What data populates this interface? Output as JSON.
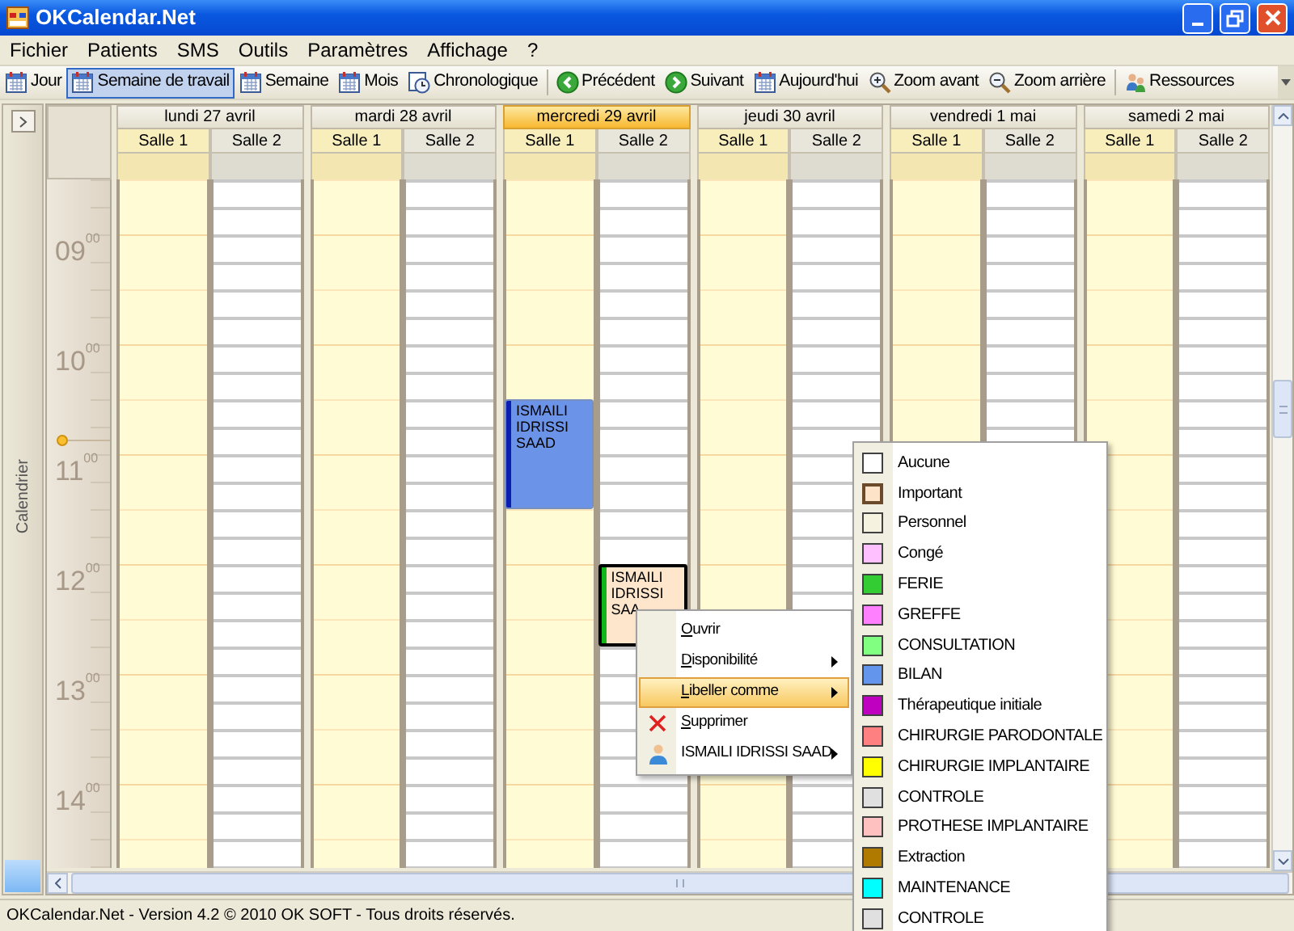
{
  "window": {
    "title": "OKCalendar.Net"
  },
  "menu_bar": [
    "Fichier",
    "Patients",
    "SMS",
    "Outils",
    "Paramètres",
    "Affichage",
    "?"
  ],
  "toolbar": {
    "groups": [
      [
        {
          "label": "Jour",
          "selected": false
        },
        {
          "label": "Semaine de travail",
          "selected": true
        },
        {
          "label": "Semaine",
          "selected": false
        },
        {
          "label": "Mois",
          "selected": false
        },
        {
          "label": "Chronologique",
          "selected": false
        }
      ],
      [
        {
          "label": "Précédent",
          "selected": false
        },
        {
          "label": "Suivant",
          "selected": false
        },
        {
          "label": "Aujourd'hui",
          "selected": false
        },
        {
          "label": "Zoom avant",
          "selected": false
        },
        {
          "label": "Zoom arrière",
          "selected": false
        }
      ],
      [
        {
          "label": "Ressources",
          "selected": false
        }
      ]
    ]
  },
  "side_panel": {
    "title": "Calendrier"
  },
  "calendar": {
    "hours": [
      "09$^{00}$",
      "10$^{00}$",
      "11$^{00}$",
      "12$^{00}$",
      "13$^{00}$",
      "14$^{00}$"
    ],
    "days": [
      {
        "label": "lundi 27 avril",
        "today": false,
        "rooms": [
          {
            "label": "Salle 1"
          },
          {
            "label": "Salle 2"
          }
        ]
      },
      {
        "label": "mardi 28 avril",
        "today": false,
        "rooms": [
          {
            "label": "Salle 1"
          },
          {
            "label": "Salle 2"
          }
        ]
      },
      {
        "label": "mercredi 29 avril",
        "today": true,
        "rooms": [
          {
            "label": "Salle 1",
            "appointments": [
              {
                "text": "ISMAILI IDRISSI SAAD",
                "color": "#6b94e8",
                "selected": false
              }
            ]
          },
          {
            "label": "Salle 2",
            "appointments": [
              {
                "text": "ISMAILI IDRISSI SAA",
                "color": "#fde6cc",
                "selected": true
              }
            ]
          }
        ]
      },
      {
        "label": "jeudi 30 avril",
        "today": false,
        "rooms": [
          {
            "label": "Salle 1"
          },
          {
            "label": "Salle 2"
          }
        ]
      },
      {
        "label": "vendredi 1 mai",
        "today": false,
        "rooms": [
          {
            "label": "Salle 1"
          },
          {
            "label": "Salle 2"
          }
        ]
      },
      {
        "label": "samedi 2 mai",
        "today": false,
        "rooms": [
          {
            "label": "Salle 1"
          },
          {
            "label": "Salle 2"
          }
        ]
      }
    ]
  },
  "context_menu": [
    {
      "label": "Ouvrir",
      "mnemonic": true,
      "submenu": false,
      "selected": false
    },
    {
      "label": "Disponibilité",
      "mnemonic": true,
      "submenu": true,
      "selected": false
    },
    {
      "label": "Libeller comme",
      "mnemonic": true,
      "submenu": true,
      "selected": true
    },
    {
      "label": "Supprimer",
      "mnemonic": true,
      "submenu": false,
      "selected": false,
      "kind": "delete"
    },
    {
      "label": "ISMAILI IDRISSI SAAD",
      "mnemonic": false,
      "submenu": true,
      "selected": false,
      "kind": "patient"
    }
  ],
  "label_submenu": [
    {
      "label": "Aucune",
      "color": "#ffffff",
      "selected": false
    },
    {
      "label": "Important",
      "color": "#fde3c8",
      "selected": true
    },
    {
      "label": "Personnel",
      "color": "#f5f3e0",
      "selected": false
    },
    {
      "label": "Congé",
      "color": "#ffc0ff",
      "selected": false
    },
    {
      "label": "FERIE",
      "color": "#33cc33",
      "selected": false
    },
    {
      "label": "GREFFE",
      "color": "#ff80ff",
      "selected": false
    },
    {
      "label": "CONSULTATION",
      "color": "#80ff80",
      "selected": false
    },
    {
      "label": "BILAN",
      "color": "#6495ed",
      "selected": false
    },
    {
      "label": "Thérapeutique initiale",
      "color": "#c000c0",
      "selected": false
    },
    {
      "label": "CHIRURGIE PARODONTALE",
      "color": "#ff8080",
      "selected": false
    },
    {
      "label": "CHIRURGIE IMPLANTAIRE",
      "color": "#ffff00",
      "selected": false
    },
    {
      "label": "CONTROLE",
      "color": "#e0e0e0",
      "selected": false
    },
    {
      "label": "PROTHESE IMPLANTAIRE",
      "color": "#ffc0c0",
      "selected": false
    },
    {
      "label": "Extraction",
      "color": "#b07a00",
      "selected": false
    },
    {
      "label": "MAINTENANCE",
      "color": "#00ffff",
      "selected": false
    },
    {
      "label": "CONTROLE",
      "color": "#e0e0e0",
      "selected": false
    }
  ],
  "status_bar": "OKCalendar.Net - Version 4.2 © 2010 OK SOFT - Tous droits réservés."
}
